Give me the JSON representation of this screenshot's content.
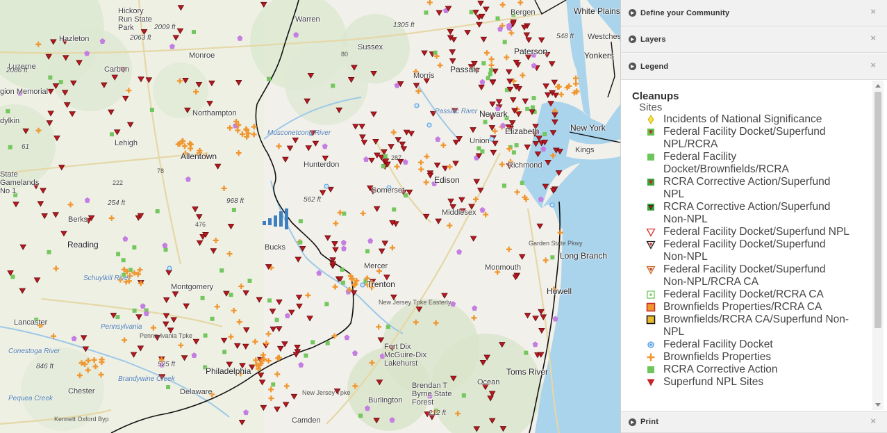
{
  "map": {
    "places": [
      {
        "id": "hazleton",
        "text": "Hazleton"
      },
      {
        "id": "hickory",
        "text": "Hickory\nRun State\nPark"
      },
      {
        "id": "luzerne",
        "text": "Luzerne"
      },
      {
        "id": "monroe",
        "text": "Monroe"
      },
      {
        "id": "carbon",
        "text": "Carbon"
      },
      {
        "id": "warren",
        "text": "Warren"
      },
      {
        "id": "sussex",
        "text": "Sussex"
      },
      {
        "id": "morris",
        "text": "Morris"
      },
      {
        "id": "passaic",
        "text": "Passaic"
      },
      {
        "id": "paterson",
        "text": "Paterson"
      },
      {
        "id": "bergen",
        "text": "Bergen"
      },
      {
        "id": "whiteplains",
        "text": "White Plains"
      },
      {
        "id": "yonkers",
        "text": "Yonkers"
      },
      {
        "id": "westchester",
        "text": "Westches"
      },
      {
        "id": "northampton",
        "text": "Northampton"
      },
      {
        "id": "lehigh",
        "text": "Lehigh"
      },
      {
        "id": "allentown",
        "text": "Allentown"
      },
      {
        "id": "hunterdon",
        "text": "Hunterdon"
      },
      {
        "id": "somerset",
        "text": "Somerset"
      },
      {
        "id": "edison",
        "text": "Edison"
      },
      {
        "id": "elizabeth",
        "text": "Elizabeth"
      },
      {
        "id": "newark",
        "text": "Newark"
      },
      {
        "id": "union",
        "text": "Union"
      },
      {
        "id": "richmond",
        "text": "Richmond"
      },
      {
        "id": "newyork",
        "text": "New York"
      },
      {
        "id": "kings",
        "text": "Kings"
      },
      {
        "id": "middlesex",
        "text": "Middlesex"
      },
      {
        "id": "berks",
        "text": "Berks"
      },
      {
        "id": "reading",
        "text": "Reading"
      },
      {
        "id": "bucks",
        "text": "Bucks"
      },
      {
        "id": "mercer",
        "text": "Mercer"
      },
      {
        "id": "trenton",
        "text": "Trenton"
      },
      {
        "id": "monmouth",
        "text": "Monmouth"
      },
      {
        "id": "longbranch",
        "text": "Long Branch"
      },
      {
        "id": "howell",
        "text": "Howell"
      },
      {
        "id": "montgomery",
        "text": "Montgomery"
      },
      {
        "id": "lancaster",
        "text": "Lancaster"
      },
      {
        "id": "chester",
        "text": "Chester"
      },
      {
        "id": "delaware",
        "text": "Delaware"
      },
      {
        "id": "philadelphia",
        "text": "Philadelphia"
      },
      {
        "id": "burlington",
        "text": "Burlington"
      },
      {
        "id": "camden",
        "text": "Camden"
      },
      {
        "id": "mcguire",
        "text": "Fort Dix\nMcGuire-Dix\nLakehurst"
      },
      {
        "id": "brendan",
        "text": "Brendan T\nByrne State\nForest"
      },
      {
        "id": "ocean",
        "text": "Ocean"
      },
      {
        "id": "tomsriver",
        "text": "Toms River"
      },
      {
        "id": "state_gamelands",
        "text": "State\nGamelands\nNo 1"
      },
      {
        "id": "dylkin",
        "text": "dylkin"
      },
      {
        "id": "region_memorial",
        "text": "gion Memorial"
      }
    ],
    "elevations": [
      {
        "id": "e1",
        "text": "2009 ft"
      },
      {
        "id": "e2",
        "text": "2063 ft"
      },
      {
        "id": "e3",
        "text": "2086 ft"
      },
      {
        "id": "e4",
        "text": "1305 ft"
      },
      {
        "id": "e5",
        "text": "548 ft"
      },
      {
        "id": "e6",
        "text": "968 ft"
      },
      {
        "id": "e7",
        "text": "562 ft"
      },
      {
        "id": "e8",
        "text": "254 ft"
      },
      {
        "id": "e9",
        "text": "525 ft"
      },
      {
        "id": "e10",
        "text": "846 ft"
      },
      {
        "id": "e11",
        "text": "212 ft"
      },
      {
        "id": "e12",
        "text": "61"
      }
    ],
    "water": [
      {
        "id": "w1",
        "text": "Musconetcong River"
      },
      {
        "id": "w2",
        "text": "Passaic River"
      },
      {
        "id": "w3",
        "text": "Conestoga River"
      },
      {
        "id": "w4",
        "text": "Pennsylvania"
      },
      {
        "id": "w5",
        "text": "Pequea Creek"
      },
      {
        "id": "w6",
        "text": "Brandywine Creek"
      },
      {
        "id": "w7",
        "text": "Schuylkill River"
      }
    ],
    "roads": [
      {
        "id": "r1",
        "text": "80"
      },
      {
        "id": "r2",
        "text": "287"
      },
      {
        "id": "r3",
        "text": "476"
      },
      {
        "id": "r4",
        "text": "222"
      },
      {
        "id": "r5",
        "text": "78"
      },
      {
        "id": "r6",
        "text": "New Jersey Tpke"
      },
      {
        "id": "r7",
        "text": "New Jersey Tpke Easterly"
      },
      {
        "id": "r8",
        "text": "Garden State Pkwy"
      },
      {
        "id": "r9",
        "text": "Kennett Oxford Byp"
      },
      {
        "id": "r10",
        "text": "Pennsylvania Tpke"
      }
    ]
  },
  "panel": {
    "sections": [
      {
        "id": "define",
        "title": "Define your Community"
      },
      {
        "id": "layers",
        "title": "Layers"
      },
      {
        "id": "legend",
        "title": "Legend"
      },
      {
        "id": "print",
        "title": "Print"
      }
    ],
    "close_glyph": "×",
    "collapse_glyph": "▸",
    "legend": {
      "title": "Cleanups",
      "subtitle": "Sites",
      "items": [
        {
          "label": "Incidents of National Significance",
          "icon": "yellow-diamond-icon",
          "color": "#f6e049"
        },
        {
          "label": "Federal Facility Docket/Superfund NPL/RCRA",
          "icon": "green-square-red-triangle-icon",
          "color": "#63c34c"
        },
        {
          "label": "Federal Facility Docket/Brownfields/RCRA",
          "icon": "green-square-icon",
          "color": "#6cc659"
        },
        {
          "label": "RCRA Corrective Action/Superfund NPL",
          "icon": "green-square-red-triangle-icon",
          "color": "#3aa33a"
        },
        {
          "label": "RCRA Corrective Action/Superfund Non-NPL",
          "icon": "green-square-black-triangle-icon",
          "color": "#3aa33a"
        },
        {
          "label": "Federal Facility Docket/Superfund NPL",
          "icon": "red-outline-triangle-icon",
          "color": "#d9302c"
        },
        {
          "label": "Federal Facility Docket/Superfund Non-NPL",
          "icon": "black-outline-triangle-icon",
          "color": "#222222"
        },
        {
          "label": "Federal Facility Docket/Superfund Non-NPL/RCRA CA",
          "icon": "orange-outline-triangle-icon",
          "color": "#c86f2a"
        },
        {
          "label": "Federal Facility Docket/RCRA CA",
          "icon": "green-outline-square-icon",
          "color": "#6cc659"
        },
        {
          "label": "Brownfields Properties/RCRA CA",
          "icon": "orange-square-icon",
          "color": "#f0962e"
        },
        {
          "label": "Brownfields/RCRA CA/Superfund Non-NPL",
          "icon": "yellow-black-square-icon",
          "color": "#e8b830"
        },
        {
          "label": "Federal Facility Docket",
          "icon": "blue-dot-icon",
          "color": "#4d9ee6"
        },
        {
          "label": "Brownfields Properties",
          "icon": "orange-plus-icon",
          "color": "#f0962e"
        },
        {
          "label": "RCRA Corrective Action",
          "icon": "green-square-icon",
          "color": "#6cc659"
        },
        {
          "label": "Superfund NPL Sites",
          "icon": "red-triangle-icon",
          "color": "#c42427"
        }
      ]
    }
  },
  "colors": {
    "superfund_red": "#b8171e",
    "brownfield_orange": "#f0962e",
    "rcra_green": "#73c75e",
    "tri_purple": "#c47de0",
    "water_blue": "#aad3ec"
  }
}
